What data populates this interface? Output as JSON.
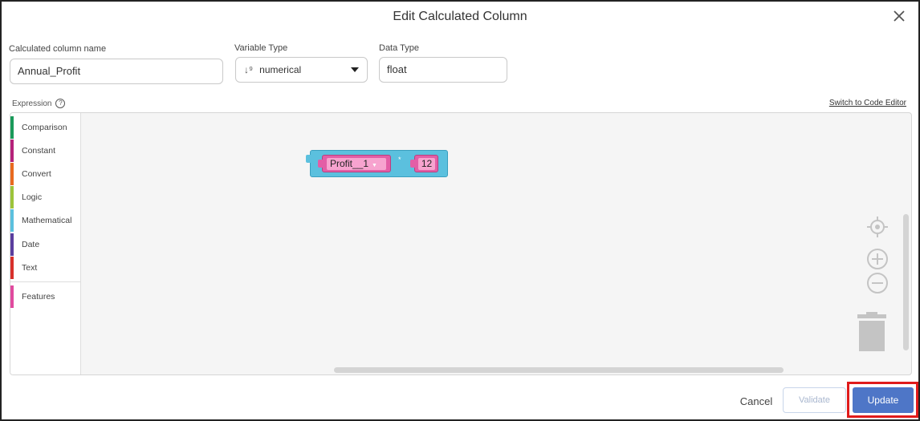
{
  "dialog": {
    "title": "Edit Calculated Column",
    "close_icon": "close-icon"
  },
  "form": {
    "name_label": "Calculated column name",
    "name_value": "Annual_Profit",
    "variable_type_label": "Variable Type",
    "variable_type_value": "numerical",
    "variable_type_icon": "sort-numeric-icon",
    "data_type_label": "Data Type",
    "data_type_value": "float"
  },
  "expression": {
    "label": "Expression",
    "help_icon": "help-icon",
    "switch_link": "Switch to Code Editor"
  },
  "toolbox": {
    "items": [
      {
        "label": "Comparison",
        "color": "#1a9a5a"
      },
      {
        "label": "Constant",
        "color": "#b5227a"
      },
      {
        "label": "Convert",
        "color": "#e86a1f"
      },
      {
        "label": "Logic",
        "color": "#9cc43a"
      },
      {
        "label": "Mathematical",
        "color": "#5bc0de"
      },
      {
        "label": "Date",
        "color": "#5a3e9e"
      },
      {
        "label": "Text",
        "color": "#d8302b"
      },
      {
        "label": "Features",
        "color": "#e04a9e"
      }
    ]
  },
  "block": {
    "operand_a": "Profit__1",
    "operator": "*",
    "operand_b": "12",
    "colors": {
      "outer": "#5bc0de",
      "inner": "#e35ea6"
    }
  },
  "workspace_controls": [
    "recenter-icon",
    "zoom-in-icon",
    "zoom-out-icon",
    "trash-icon"
  ],
  "footer": {
    "cancel": "Cancel",
    "validate": "Validate",
    "update": "Update",
    "accent": "#4e76c7",
    "highlight_color": "#e01b1b"
  }
}
